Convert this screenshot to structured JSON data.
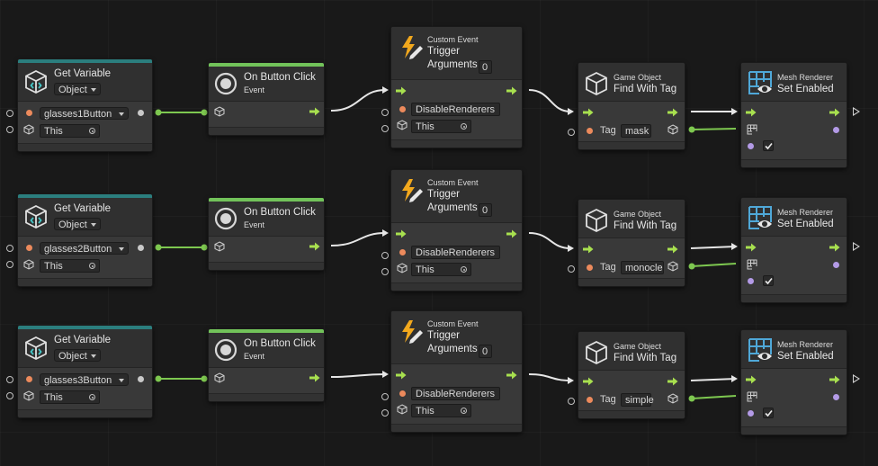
{
  "rows": [
    {
      "get_variable": {
        "title": "Get Variable",
        "kind": "Object",
        "variable": "glasses1Button",
        "source": "This"
      },
      "on_click": {
        "title": "On Button Click",
        "subtitle": "Event"
      },
      "trigger": {
        "category": "Custom Event",
        "title": "Trigger",
        "args_label": "Arguments",
        "args_count": "0",
        "event_name": "DisableRenderers",
        "target": "This"
      },
      "find": {
        "category": "Game Object",
        "title": "Find With Tag",
        "tag_label": "Tag",
        "tag": "mask"
      },
      "mesh": {
        "category": "Mesh Renderer",
        "title": "Set Enabled"
      }
    },
    {
      "get_variable": {
        "title": "Get Variable",
        "kind": "Object",
        "variable": "glasses2Button",
        "source": "This"
      },
      "on_click": {
        "title": "On Button Click",
        "subtitle": "Event"
      },
      "trigger": {
        "category": "Custom Event",
        "title": "Trigger",
        "args_label": "Arguments",
        "args_count": "0",
        "event_name": "DisableRenderers",
        "target": "This"
      },
      "find": {
        "category": "Game Object",
        "title": "Find With Tag",
        "tag_label": "Tag",
        "tag": "monocle"
      },
      "mesh": {
        "category": "Mesh Renderer",
        "title": "Set Enabled"
      }
    },
    {
      "get_variable": {
        "title": "Get Variable",
        "kind": "Object",
        "variable": "glasses3Button",
        "source": "This"
      },
      "on_click": {
        "title": "On Button Click",
        "subtitle": "Event"
      },
      "trigger": {
        "category": "Custom Event",
        "title": "Trigger",
        "args_label": "Arguments",
        "args_count": "0",
        "event_name": "DisableRenderers",
        "target": "This"
      },
      "find": {
        "category": "Game Object",
        "title": "Find With Tag",
        "tag_label": "Tag",
        "tag": "simple"
      },
      "mesh": {
        "category": "Mesh Renderer",
        "title": "Set Enabled"
      }
    }
  ],
  "colors": {
    "background": "#191919",
    "node": "#393939",
    "header_bar_variable": "#2b7e7e",
    "header_bar_event": "#72c35a",
    "control_flow": "#a8e04f",
    "value_wire": "#7ec850",
    "object_port": "#ec8a5c",
    "bool_port": "#b39ae6",
    "lightning": "#f2a81d",
    "mesh_icon": "#4fa8d8"
  },
  "icons": {
    "get_variable": "variable-cube-icon",
    "on_click": "radio-button-icon",
    "trigger": "lightning-pen-icon",
    "find": "cube-icon",
    "mesh": "mesh-grid-eye-icon"
  }
}
